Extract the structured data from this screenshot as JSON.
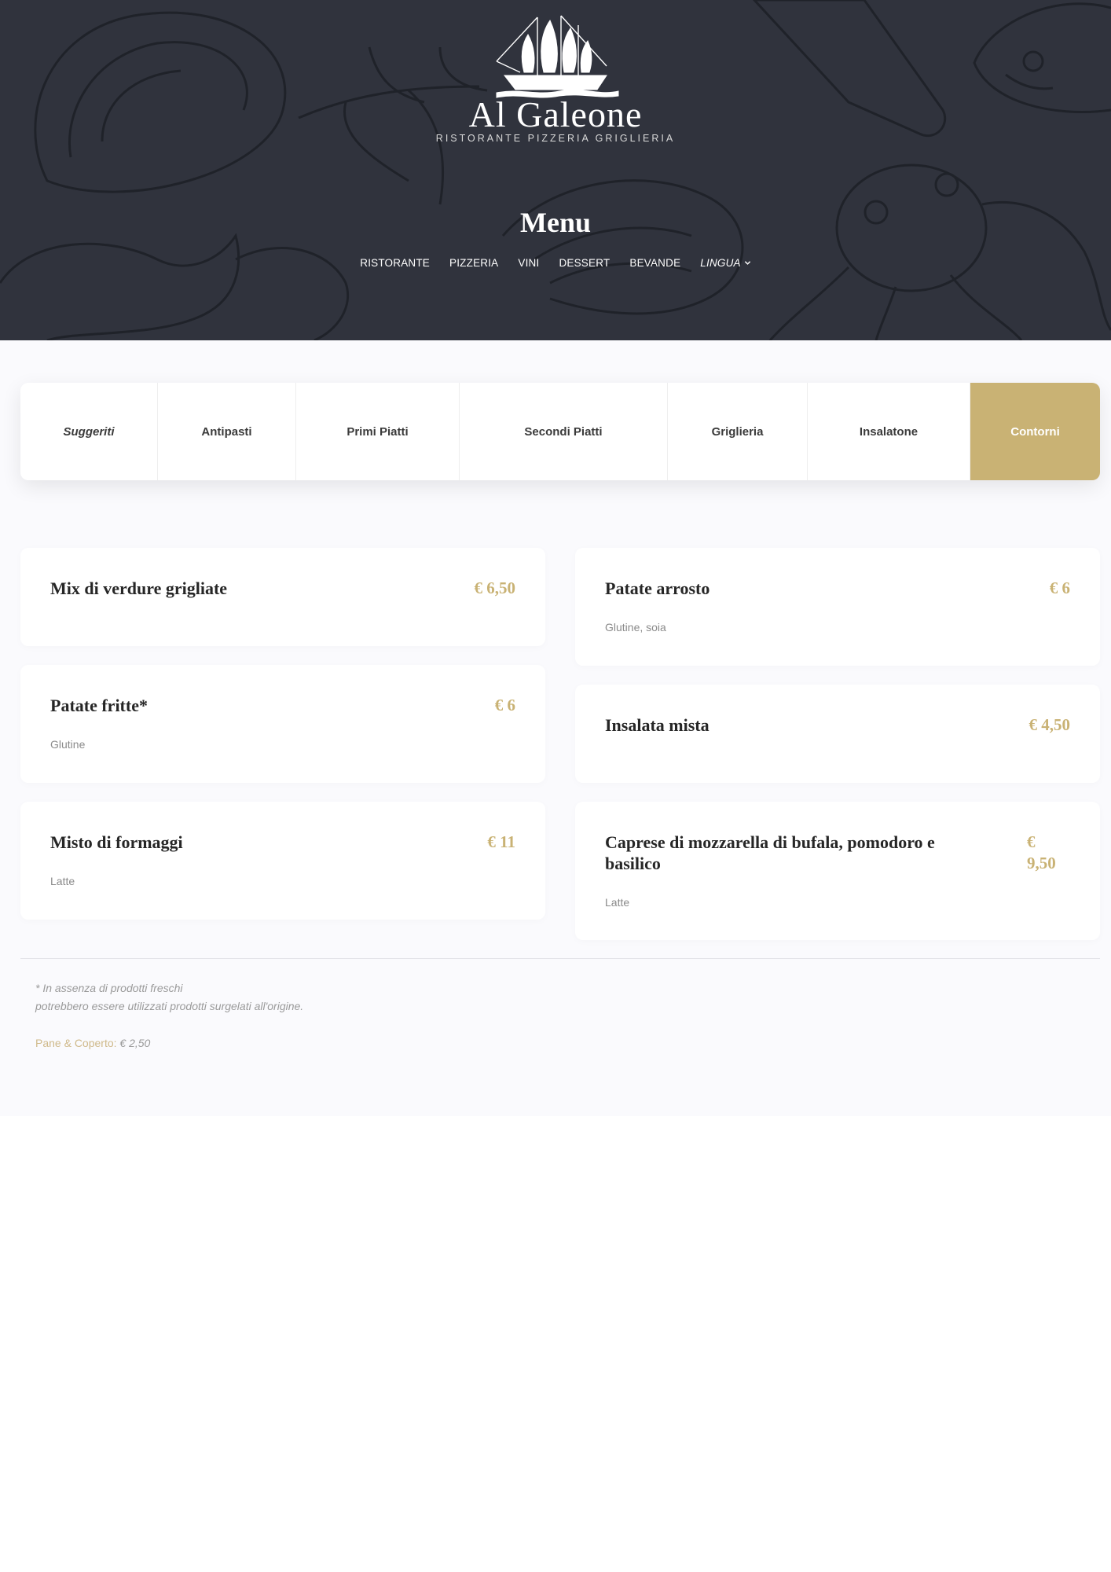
{
  "brand": {
    "name_part1": "Al",
    "name_part2": "Galeone",
    "tagline": "RISTORANTE PIZZERIA GRIGLIERIA",
    "logo_icon": "galleon-ship-icon"
  },
  "hero": {
    "title": "Menu",
    "nav": [
      {
        "label": "RISTORANTE"
      },
      {
        "label": "PIZZERIA"
      },
      {
        "label": "VINI"
      },
      {
        "label": "DESSERT"
      },
      {
        "label": "BEVANDE"
      }
    ],
    "language": {
      "label": "LINGUA",
      "icon": "chevron-down-icon"
    }
  },
  "tabs": [
    {
      "label": "Suggeriti"
    },
    {
      "label": "Antipasti"
    },
    {
      "label": "Primi Piatti"
    },
    {
      "label": "Secondi Piatti"
    },
    {
      "label": "Griglieria"
    },
    {
      "label": "Insalatone"
    },
    {
      "label": "Contorni",
      "active": true
    }
  ],
  "items": [
    {
      "name": "Mix di verdure grigliate",
      "price": "€ 6,50",
      "allergens": ""
    },
    {
      "name": "Patate arrosto",
      "price": "€ 6",
      "allergens": "Glutine, soia"
    },
    {
      "name": "Patate fritte*",
      "price": "€ 6",
      "allergens": "Glutine"
    },
    {
      "name": "Insalata mista",
      "price": "€ 4,50",
      "allergens": ""
    },
    {
      "name": "Misto di formaggi",
      "price": "€ 11",
      "allergens": "Latte"
    },
    {
      "name": "Caprese di mozzarella di bufala, pomodoro e basilico",
      "price_line1": "€",
      "price_line2": "9,50",
      "allergens": "Latte"
    }
  ],
  "footer": {
    "note_line1": "* In assenza di prodotti freschi",
    "note_line2": "potrebbero essere utilizzati prodotti surgelati all'origine.",
    "cover_label": "Pane & Coperto:",
    "cover_value": "€ 2,50"
  },
  "colors": {
    "hero_bg": "#30333d",
    "accent_gold": "#c9b274",
    "page_bg": "#fafafd"
  }
}
